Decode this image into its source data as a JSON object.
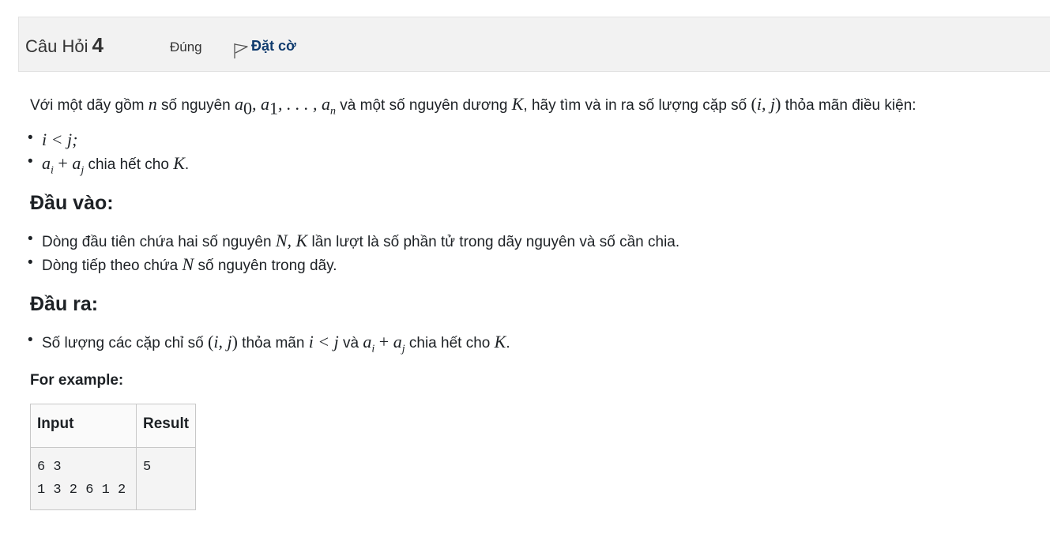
{
  "header": {
    "title": "Câu Hỏi",
    "number": "4",
    "state": "Đúng",
    "flag_label": "Đặt cờ"
  },
  "intro": {
    "t1": "Với một dãy gồm ",
    "m1": "n",
    "t2": " số nguyên ",
    "t3": " và một số nguyên dương ",
    "m3": "K",
    "t4": ", hãy tìm và in ra số lượng cặp số ",
    "t5": " thỏa mãn điều kiện:"
  },
  "conditions": {
    "c1": "i < j;",
    "c2_text": " chia hết cho ",
    "c2_k": "K",
    "c2_end": "."
  },
  "input_section": {
    "heading": "Đầu vào:",
    "l1_a": "Dòng đầu tiên chứa hai số nguyên ",
    "l1_m": "N, K",
    "l1_b": " lần lượt là số phần tử trong dãy nguyên và số cần chia.",
    "l2_a": "Dòng tiếp theo chứa ",
    "l2_m": "N",
    "l2_b": " số nguyên trong dãy."
  },
  "output_section": {
    "heading": "Đầu ra:",
    "l1_a": "Số lượng các cặp chỉ số ",
    "l1_b": " thỏa mãn ",
    "l1_m1": "i < j",
    "l1_c": " và ",
    "l1_d": " chia hết cho ",
    "l1_k": "K",
    "l1_end": "."
  },
  "example": {
    "label": "For example:",
    "headers": [
      "Input",
      "Result"
    ],
    "rows": [
      {
        "input": "6 3\n1 3 2 6 1 2",
        "result": "5"
      }
    ]
  }
}
